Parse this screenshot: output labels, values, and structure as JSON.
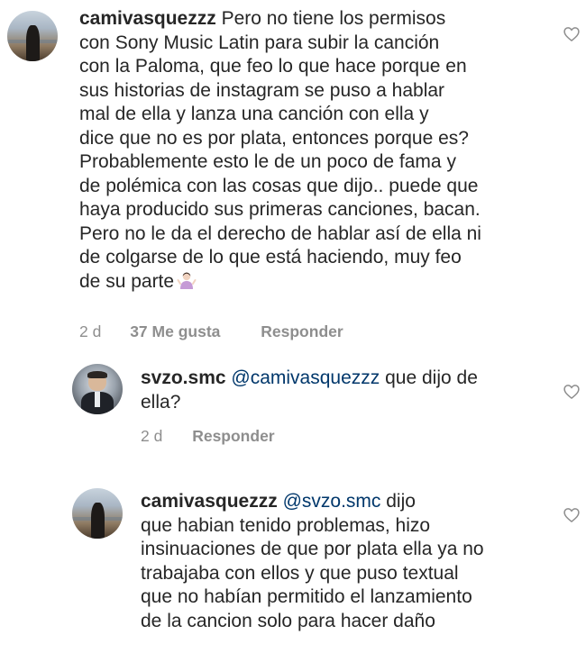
{
  "comments": [
    {
      "username": "camivasquezzz",
      "lines": [
        "Pero no tiene los permisos",
        "con Sony Music Latin para subir la canción",
        "con la Paloma, que feo lo que hace porque en",
        "sus historias de instagram se puso a hablar",
        "mal de ella y lanza una canción con ella y",
        "dice que no es por plata, entonces porque es?",
        "Probablemente esto le de un poco de fama y",
        "de polémica con las cosas que dijo.. puede que",
        "haya producido sus primeras canciones, bacan.",
        "Pero no le da el derecho de hablar así de ella ni",
        "de colgarse de lo que está haciendo, muy feo",
        "de su parte"
      ],
      "emoji": "person-shrugging-emoji",
      "time": "2 d",
      "likes": "37 Me gusta",
      "reply": "Responder"
    },
    {
      "username": "svzo.smc",
      "mention": "@camivasquezzz",
      "lines": [
        " que dijo de",
        "ella?"
      ],
      "time": "2 d",
      "reply": "Responder"
    },
    {
      "username": "camivasquezzz",
      "mention": "@svzo.smc",
      "lines": [
        " dijo",
        "que habian tenido problemas, hizo",
        "insinuaciones de que por plata ella ya no",
        "trabajaba con ellos y que puso textual",
        "que no habían permitido el lanzamiento",
        "de la cancion solo para hacer daño"
      ]
    }
  ],
  "icons": {
    "like": "heart-outline-icon"
  },
  "colors": {
    "text": "#262626",
    "meta": "#8e8e8e",
    "mention": "#00376b"
  }
}
